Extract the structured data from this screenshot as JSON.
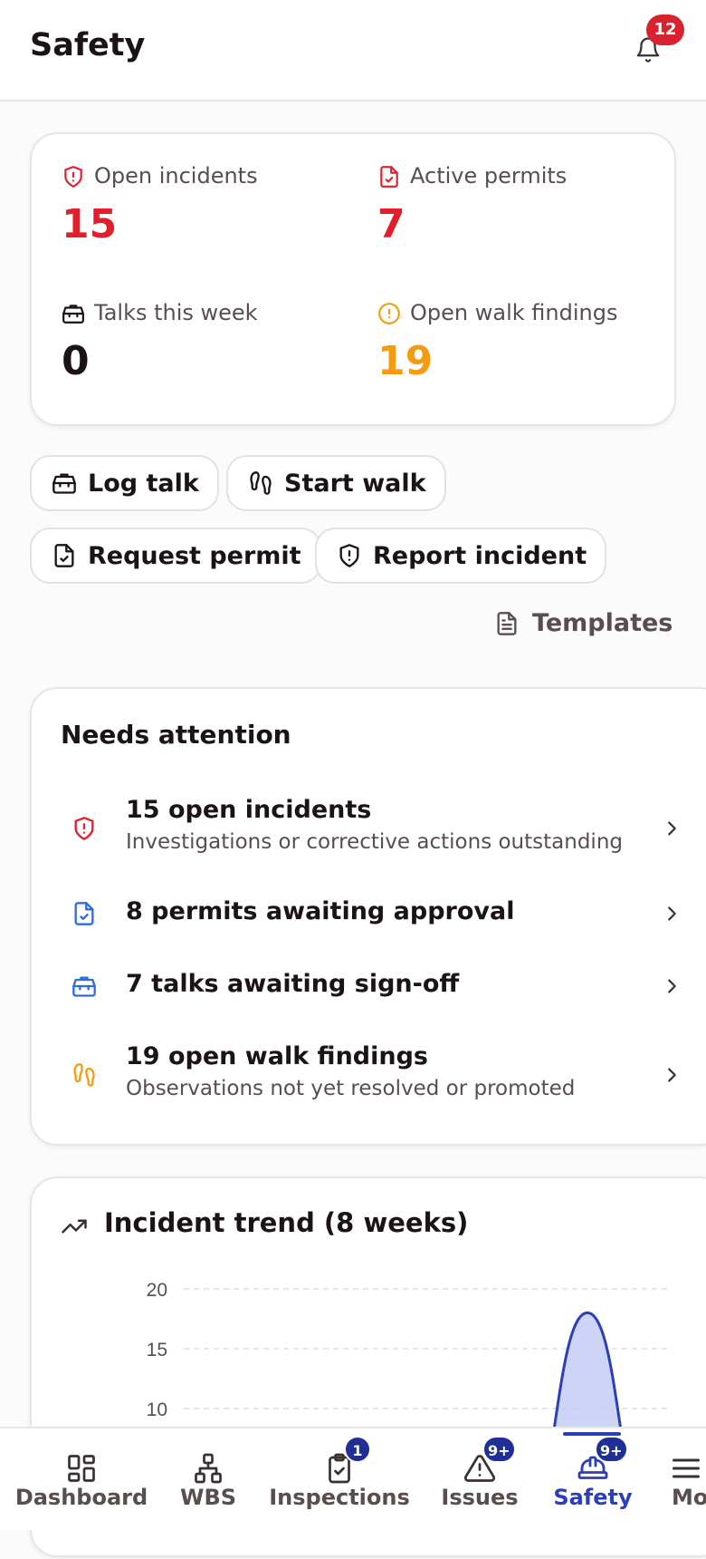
{
  "header": {
    "title": "Safety",
    "notification_count": "12"
  },
  "stats": [
    {
      "label": "Open incidents",
      "value": "15",
      "icon": "shield-alert-icon",
      "color": "#e21d2c"
    },
    {
      "label": "Active permits",
      "value": "7",
      "icon": "file-check-icon",
      "color": "#e21d2c"
    },
    {
      "label": "Talks this week",
      "value": "0",
      "icon": "toolbox-icon",
      "color": "#1c1414"
    },
    {
      "label": "Open walk findings",
      "value": "19",
      "icon": "alert-circle-icon",
      "color": "#f39c12"
    }
  ],
  "actions": {
    "log_talk": "Log talk",
    "start_walk": "Start walk",
    "request_permit": "Request permit",
    "report_incident": "Report incident",
    "templates": "Templates"
  },
  "attention": {
    "title": "Needs attention",
    "items": [
      {
        "title": "15 open incidents",
        "subtitle": "Investigations or corrective actions outstanding",
        "icon": "shield-alert-icon",
        "color": "#e21d2c"
      },
      {
        "title": "8 permits awaiting approval",
        "subtitle": "",
        "icon": "file-check-icon",
        "color": "#2b6de0"
      },
      {
        "title": "7 talks awaiting sign-off",
        "subtitle": "",
        "icon": "toolbox-icon",
        "color": "#2b6de0"
      },
      {
        "title": "19 open walk findings",
        "subtitle": "Observations not yet resolved or promoted",
        "icon": "footprints-icon",
        "color": "#f39c12"
      }
    ]
  },
  "trend": {
    "title": "Incident trend (8 weeks)"
  },
  "chart_data": {
    "type": "area",
    "title": "Incident trend (8 weeks)",
    "y_ticks": [
      "20",
      "15",
      "10"
    ],
    "ylim": [
      0,
      20
    ],
    "grid": true,
    "series": [
      {
        "values": [
          0,
          0,
          0,
          0,
          0,
          0,
          18,
          0
        ]
      }
    ],
    "series_color": "#2a3fb8"
  },
  "nav": {
    "items": [
      {
        "label": "Dashboard",
        "badge": ""
      },
      {
        "label": "WBS",
        "badge": ""
      },
      {
        "label": "Inspections",
        "badge": "1"
      },
      {
        "label": "Issues",
        "badge": "9+"
      },
      {
        "label": "Safety",
        "badge": "9+"
      },
      {
        "label": "More",
        "badge": ""
      }
    ]
  }
}
